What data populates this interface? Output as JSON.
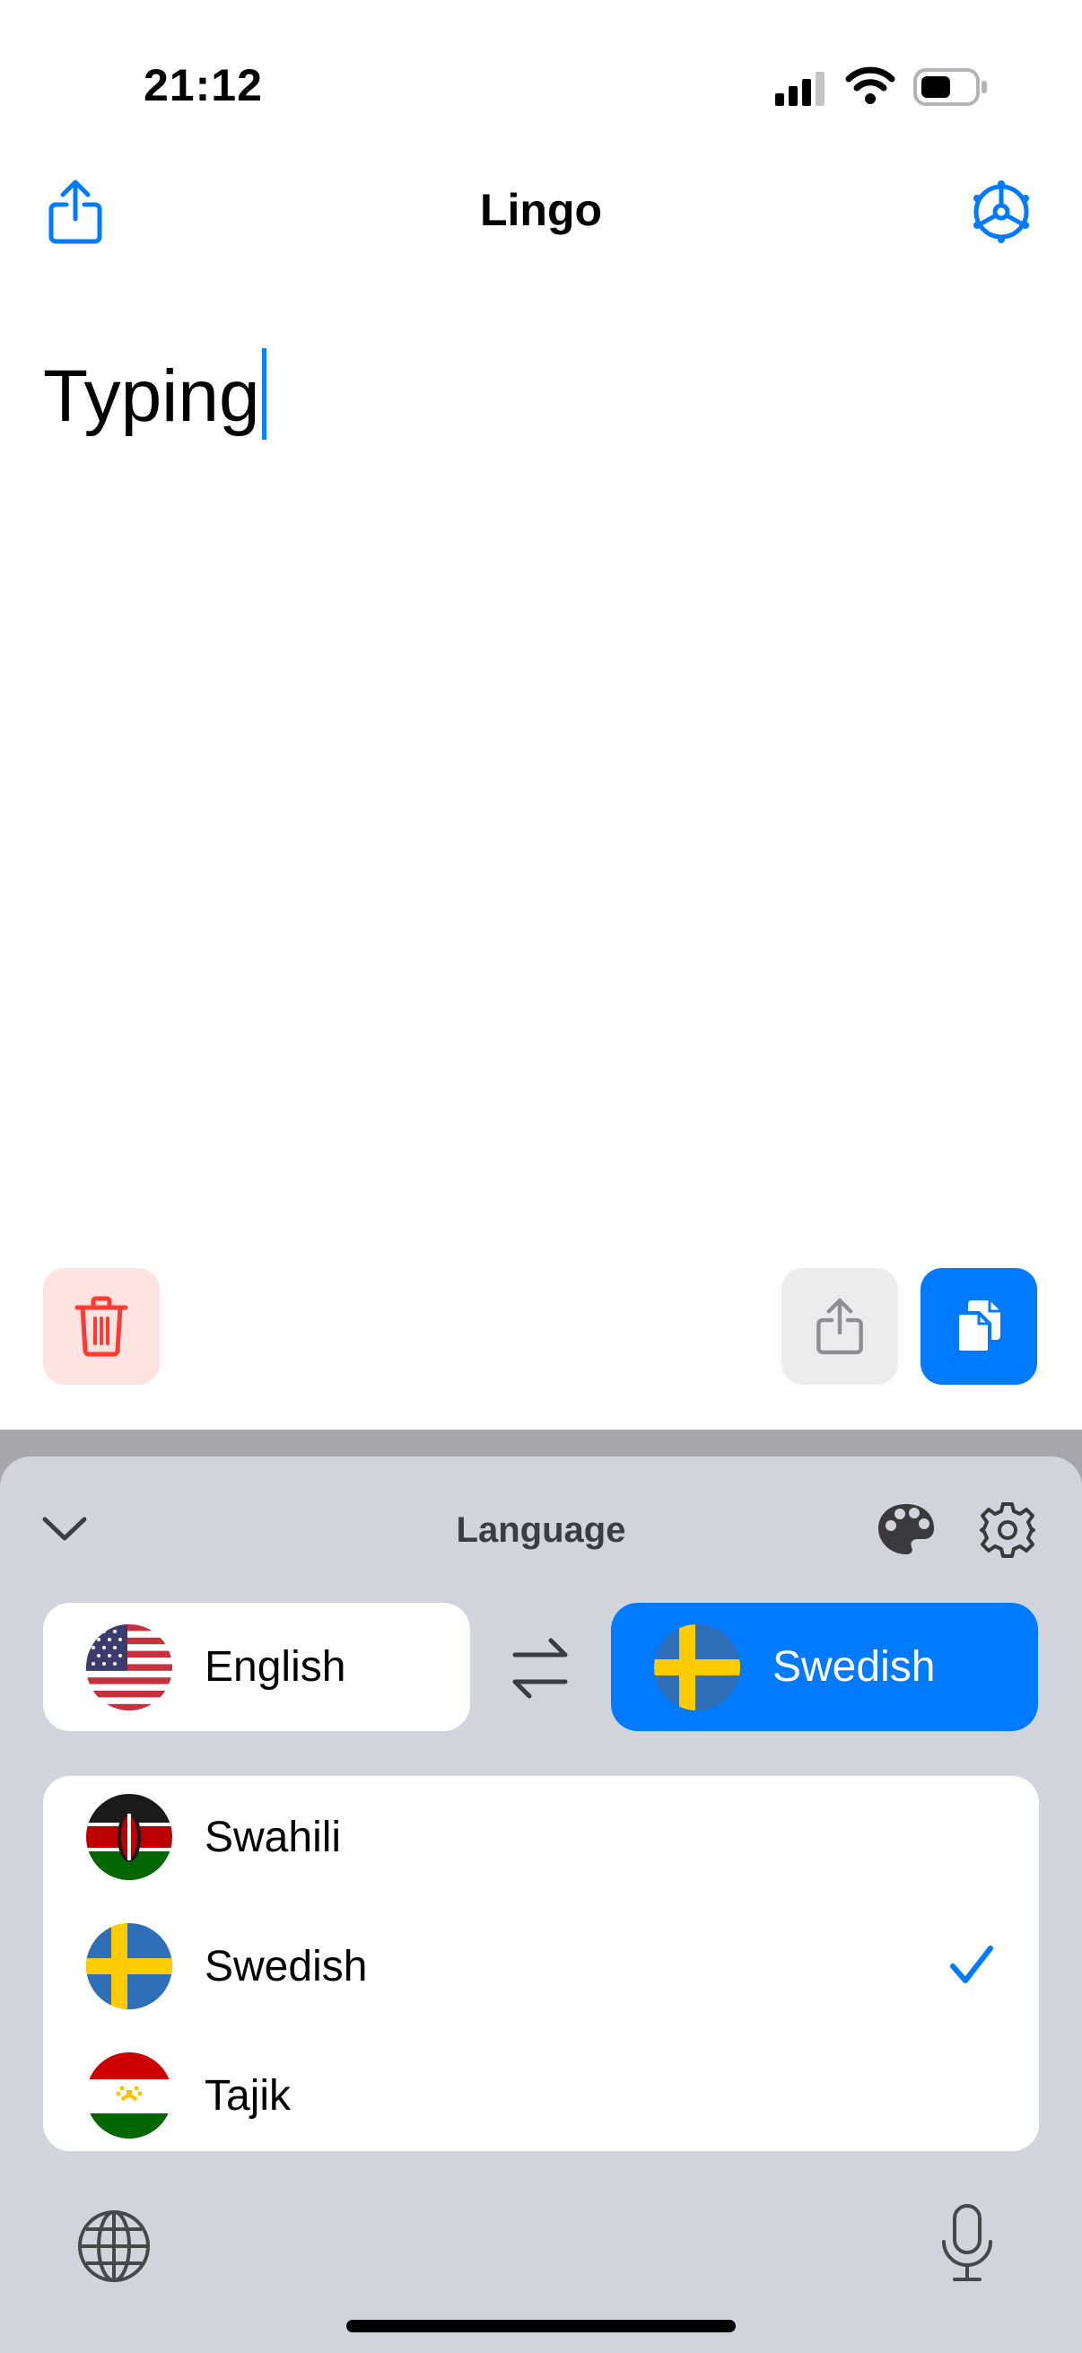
{
  "status_bar": {
    "time": "21:12"
  },
  "nav": {
    "title": "Lingo",
    "left_icon": "share-icon",
    "right_icon": "settings-wheel-icon"
  },
  "editor": {
    "text": "Typing"
  },
  "actions": {
    "delete_icon": "trash-icon",
    "share_icon": "share-icon",
    "copy_icon": "copy-icon"
  },
  "language_panel": {
    "title": "Language",
    "collapse_icon": "chevron-down-icon",
    "palette_icon": "palette-icon",
    "gear_icon": "gear-icon",
    "source_language": "English",
    "target_language": "Swedish",
    "swap_icon": "swap-arrows-icon",
    "list": [
      {
        "label": "Swahili",
        "flag": "kenya",
        "selected": false
      },
      {
        "label": "Swedish",
        "flag": "sweden",
        "selected": true
      },
      {
        "label": "Tajik",
        "flag": "tajikistan",
        "selected": false
      }
    ]
  },
  "keyboard_bar": {
    "globe_icon": "globe-icon",
    "mic_icon": "microphone-icon"
  },
  "colors": {
    "accent": "#007aff",
    "danger": "#ff3b30",
    "danger_bg": "#ffe3e1",
    "panel_bg": "#d1d4db"
  }
}
